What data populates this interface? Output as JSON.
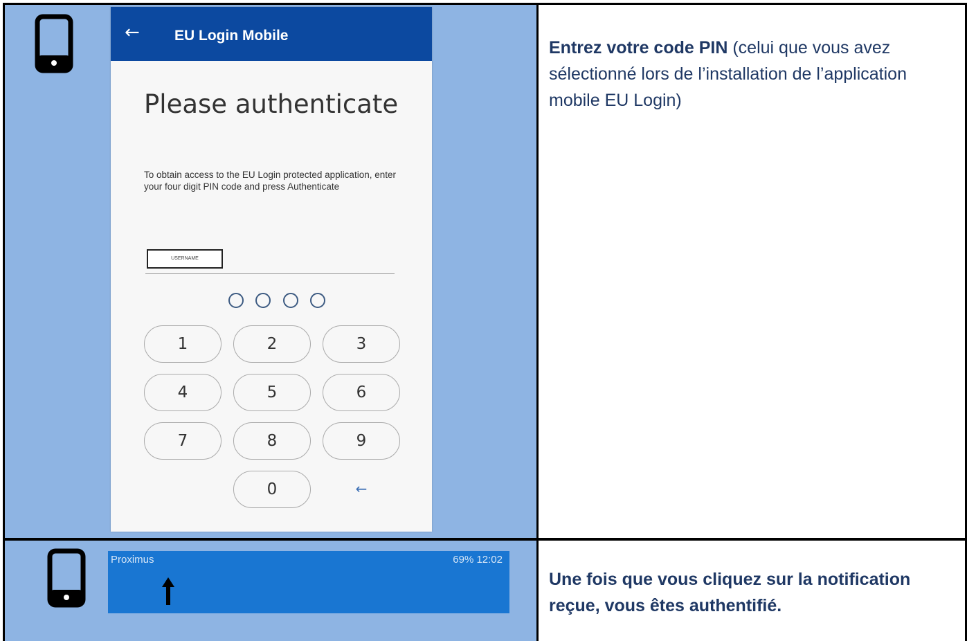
{
  "mobile_app": {
    "back_glyph": "←",
    "title": "EU Login Mobile",
    "heading": "Please authenticate",
    "description": "To obtain access to the EU Login protected application, enter your four digit PIN code and press Authenticate",
    "username_label": "USERNAME",
    "pin_length": 4,
    "keys": [
      "1",
      "2",
      "3",
      "4",
      "5",
      "6",
      "7",
      "8",
      "9",
      "0"
    ],
    "backspace_glyph": "←"
  },
  "instructions": {
    "step1_bold": "Entrez votre code PIN",
    "step1_rest": " (celui que vous avez sélectionné lors de l’installation de l’application mobile EU Login)",
    "step2": "Une fois que vous cliquez sur la notification reçue, vous êtes authentifié."
  },
  "notification_bar": {
    "carrier": "Proximus",
    "status": "69%  12:02"
  },
  "colors": {
    "left_cell_bg": "#8eb4e3",
    "app_bar": "#0c49a0",
    "text_blue": "#1f3864",
    "notif_bar": "#1976d2"
  },
  "icons": [
    "mobile-phone-icon",
    "mobile-phone-icon",
    "up-arrow-icon"
  ]
}
